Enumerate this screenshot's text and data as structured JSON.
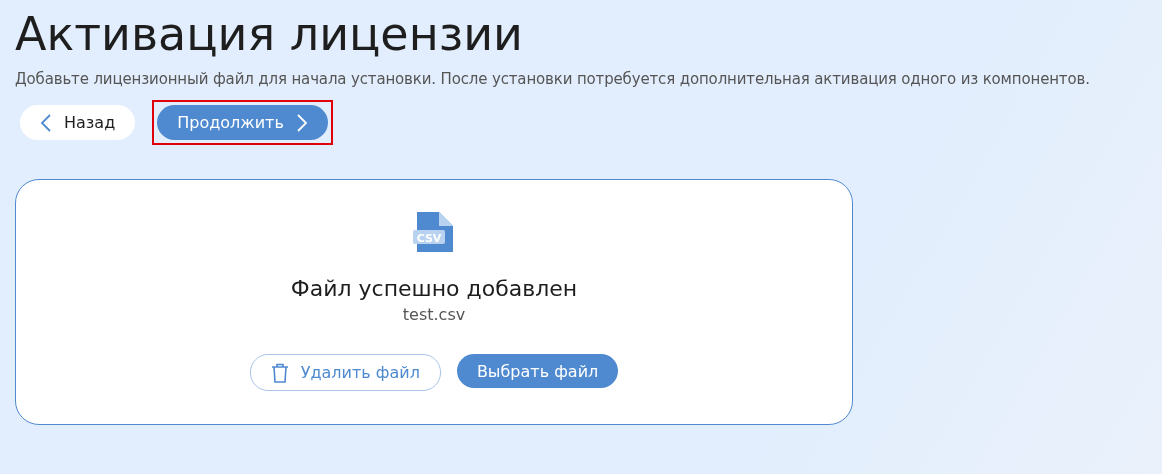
{
  "title": "Активация лицензии",
  "subtitle": "Добавьте лицензионный файл для начала установки. После установки потребуется дополнительная активация одного из компонентов.",
  "nav_buttons": [
    {
      "kind": "back",
      "label": "Назад",
      "highlighted": false
    },
    {
      "kind": "next",
      "label": "Продолжить",
      "highlighted": true
    }
  ],
  "upload_card": {
    "file_badge": "CSV",
    "status": "Файл успешно добавлен",
    "file_name": "test.csv",
    "buttons": [
      {
        "kind": "delete",
        "label": "Удалить файл"
      },
      {
        "kind": "choose",
        "label": "Выбрать файл"
      }
    ]
  }
}
